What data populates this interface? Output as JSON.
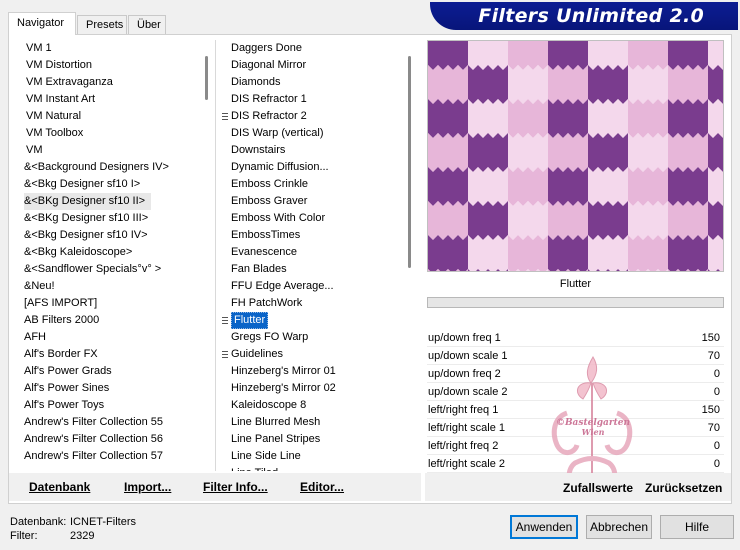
{
  "window": {
    "title": "Filters Unlimited 2.0",
    "tabs": [
      "Navigator",
      "Presets",
      "Über"
    ],
    "active_tab": "Navigator"
  },
  "categories": [
    "VM 1",
    "VM Distortion",
    "VM Extravaganza",
    "VM Instant Art",
    "VM Natural",
    "VM Toolbox",
    "VM",
    "&<Background Designers IV>",
    "&<Bkg Designer sf10 I>",
    "&<BKg Designer sf10 II>",
    "&<BKg Designer sf10 III>",
    "&<Bkg Designer sf10 IV>",
    "&<Bkg Kaleidoscope>",
    "&<Sandflower Specials°v° >",
    "&Neu!",
    "[AFS IMPORT]",
    "AB Filters 2000",
    "AFH",
    "Alf's Border FX",
    "Alf's Power Grads",
    "Alf's Power Sines",
    "Alf's Power Toys",
    "Andrew's Filter Collection 55",
    "Andrew's Filter Collection 56",
    "Andrew's Filter Collection 57"
  ],
  "filters": [
    "Daggers Done",
    "Diagonal Mirror",
    "Diamonds",
    "DIS Refractor 1",
    "DIS Refractor 2",
    "DIS Warp (vertical)",
    "Downstairs",
    "Dynamic Diffusion...",
    "Emboss Crinkle",
    "Emboss Graver",
    "Emboss With Color",
    "EmbossTimes",
    "Evanescence",
    "Fan Blades",
    "FFU Edge Average...",
    "FH PatchWork",
    "Flutter",
    "Gregs FO Warp",
    "Guidelines",
    "Hinzeberg's Mirror 01",
    "Hinzeberg's Mirror 02",
    "Kaleidoscope 8",
    "Line Blurred Mesh",
    "Line Panel Stripes",
    "Line Side Line",
    "Line Tiled"
  ],
  "selected_filter": "Flutter",
  "preview": {
    "caption": "Flutter",
    "colors": [
      "#7a3c8e",
      "#c58ac6",
      "#f4d8ec",
      "#b26cbd",
      "#e7b6d9",
      "#5a2a78"
    ]
  },
  "params": [
    {
      "label": "up/down freq 1",
      "value": "150"
    },
    {
      "label": "up/down scale 1",
      "value": "70"
    },
    {
      "label": "up/down freq 2",
      "value": "0"
    },
    {
      "label": "up/down scale 2",
      "value": "0"
    },
    {
      "label": "left/right freq 1",
      "value": "150"
    },
    {
      "label": "left/right scale 1",
      "value": "70"
    },
    {
      "label": "left/right freq 2",
      "value": "0"
    },
    {
      "label": "left/right scale 2",
      "value": "0"
    }
  ],
  "toolbar": {
    "database": "Datenbank",
    "import": "Import...",
    "filter_info": "Filter Info...",
    "editor": "Editor...",
    "randomize": "Zufallswerte",
    "reset": "Zurücksetzen"
  },
  "status": {
    "db_label": "Datenbank:",
    "db_value": "ICNET-Filters",
    "filter_label": "Filter:",
    "filter_value": "2329"
  },
  "buttons": {
    "apply": "Anwenden",
    "cancel": "Abbrechen",
    "help": "Hilfe"
  },
  "watermark": {
    "line1": "©Bastelgarten",
    "line2": "Wien"
  }
}
